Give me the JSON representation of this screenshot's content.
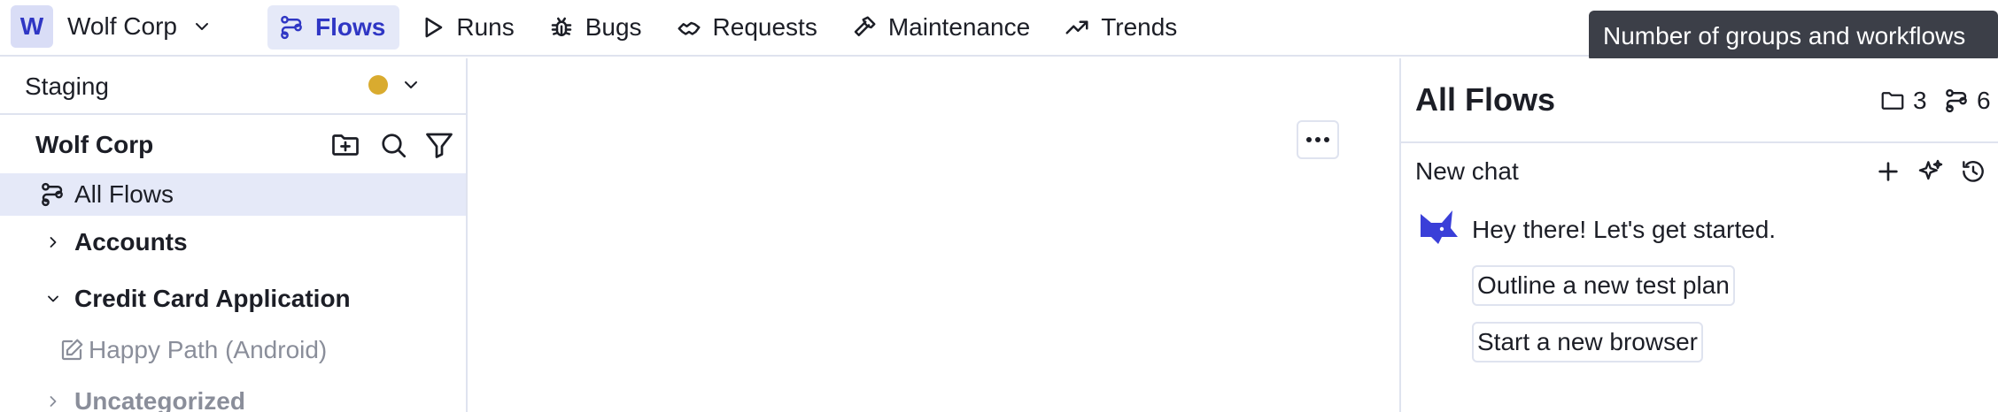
{
  "org": {
    "avatar_letter": "W",
    "name": "Wolf Corp"
  },
  "nav": {
    "items": [
      {
        "label": "Flows",
        "icon": "flows-icon",
        "active": true
      },
      {
        "label": "Runs",
        "icon": "play-icon"
      },
      {
        "label": "Bugs",
        "icon": "bug-icon"
      },
      {
        "label": "Requests",
        "icon": "handshake-icon"
      },
      {
        "label": "Maintenance",
        "icon": "hammer-icon"
      },
      {
        "label": "Trends",
        "icon": "trend-icon"
      }
    ]
  },
  "tooltip": {
    "text": "Number of groups and workflows"
  },
  "sidebar": {
    "environment": {
      "label": "Staging",
      "status_color": "#d9ab2f"
    },
    "workspace": {
      "title": "Wolf Corp"
    },
    "tree": [
      {
        "label": "All Flows",
        "selected": true
      },
      {
        "label": "Accounts",
        "expanded": false
      },
      {
        "label": "Credit Card Application",
        "expanded": true
      },
      {
        "label": "Happy Path (Android)",
        "draft": true
      },
      {
        "label": "Uncategorized",
        "expanded": false
      }
    ]
  },
  "panel": {
    "title": "All Flows",
    "group_count": "3",
    "workflow_count": "6",
    "chat": {
      "title": "New chat",
      "greeting": "Hey there! Let's get started.",
      "suggestions": [
        "Outline a new test plan",
        "Start a new browser"
      ]
    }
  },
  "colors": {
    "accent": "#2f36c4",
    "accent_bg": "#e5e9f8",
    "border": "#dfe3ef"
  }
}
